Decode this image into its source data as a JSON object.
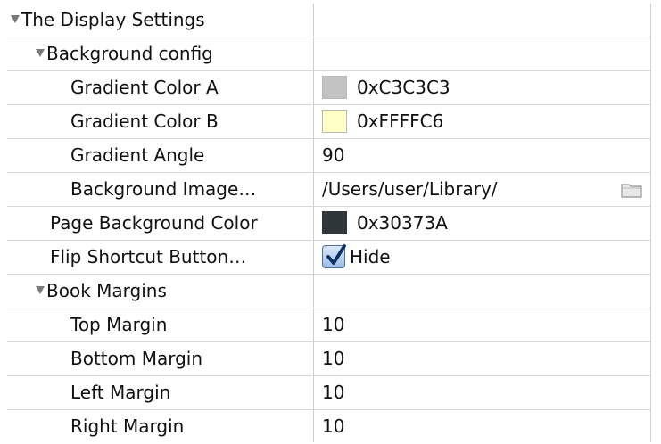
{
  "rows": [
    {
      "label": "The Display Settings",
      "value": "",
      "expanded": true,
      "level": 0
    },
    {
      "label": "Background config",
      "value": "",
      "expanded": true,
      "level": 1
    },
    {
      "label": "Gradient Color A",
      "value": "0xC3C3C3",
      "color": "#C3C3C3",
      "level": 2
    },
    {
      "label": "Gradient Color B",
      "value": "0xFFFFC6",
      "color": "#FFFFC6",
      "level": 2
    },
    {
      "label": "Gradient Angle",
      "value": "90",
      "level": 2
    },
    {
      "label": "Background Image…",
      "value": "/Users/user/Library/",
      "icon": "folder-icon",
      "level": 2
    },
    {
      "label": "Page Background Color",
      "value": "0x30373A",
      "color": "#30373A",
      "level": 1
    },
    {
      "label": "Flip Shortcut Button…",
      "value": "Hide",
      "checked": true,
      "level": 1
    },
    {
      "label": "Book Margins",
      "value": "",
      "expanded": true,
      "level": 1
    },
    {
      "label": "Top Margin",
      "value": "10",
      "level": 2
    },
    {
      "label": "Bottom Margin",
      "value": "10",
      "level": 2
    },
    {
      "label": "Left Margin",
      "value": "10",
      "level": 2
    },
    {
      "label": "Right Margin",
      "value": "10",
      "level": 2
    }
  ]
}
